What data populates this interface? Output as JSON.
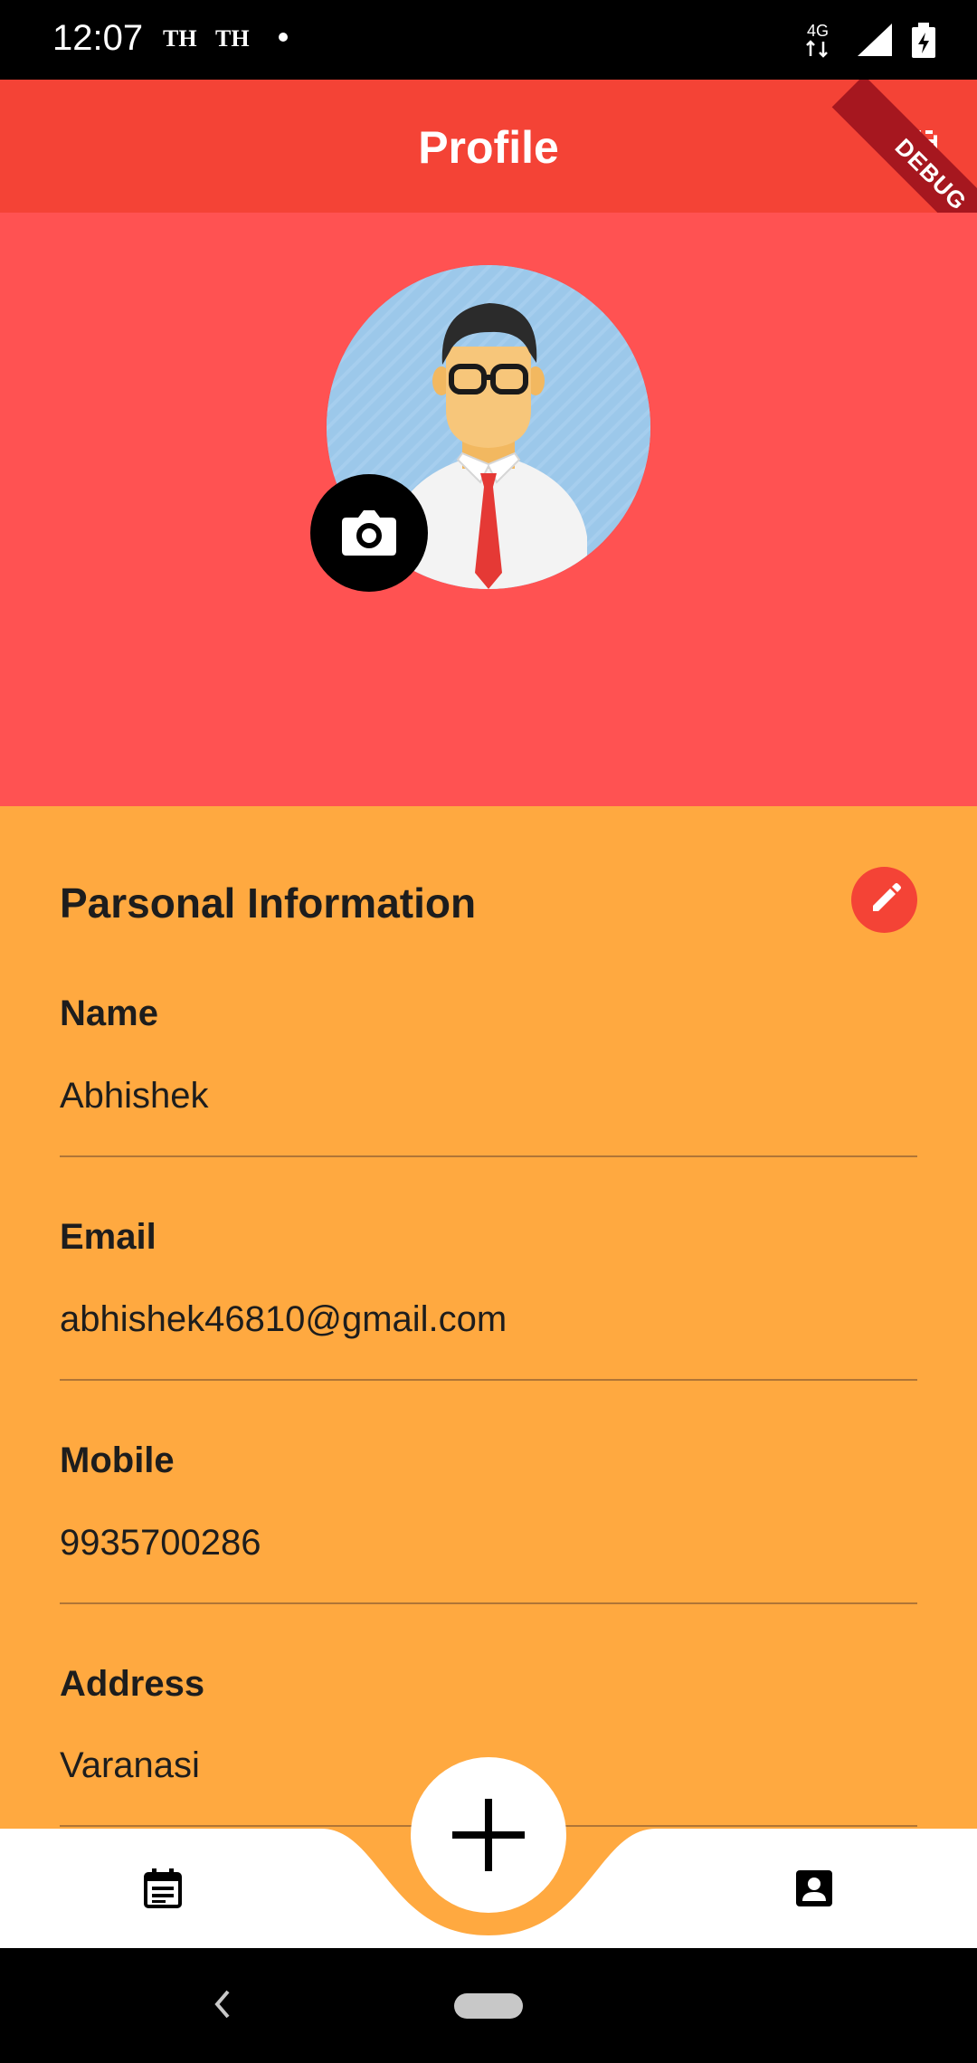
{
  "status_bar": {
    "time": "12:07",
    "notif_1": "TH",
    "notif_2": "TH",
    "network": "4G"
  },
  "app_bar": {
    "title": "Profile",
    "debug_banner": "DEBUG",
    "action_icon": "screen-rotation-icon"
  },
  "profile_header": {
    "avatar_icon": "businessman-avatar",
    "camera_icon": "camera-icon"
  },
  "personal_info": {
    "title": "Parsonal Information",
    "edit_icon": "pencil-icon",
    "fields": [
      {
        "label": "Name",
        "value": "Abhishek"
      },
      {
        "label": "Email",
        "value": "abhishek46810@gmail.com"
      },
      {
        "label": "Mobile",
        "value": "9935700286"
      },
      {
        "label": "Address",
        "value": "Varanasi"
      }
    ]
  },
  "bottom_nav": {
    "left_icon": "calendar-note-icon",
    "center_icon": "plus-icon",
    "right_icon": "contact-card-icon"
  },
  "colors": {
    "app_bar": "#F44336",
    "header": "#FF5252",
    "body": "#FFA940",
    "edit_button": "#F44336"
  }
}
